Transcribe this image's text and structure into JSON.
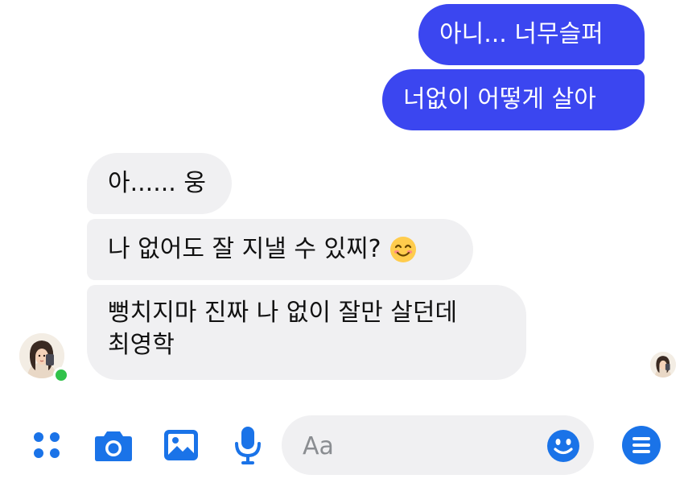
{
  "messages": {
    "sent": [
      {
        "text": "아니... 너무슬퍼"
      },
      {
        "text": "너없이 어떻게 살아"
      }
    ],
    "received": [
      {
        "text": "아...... 웅"
      },
      {
        "text": "나 없어도 잘 지낼 수 있찌?"
      },
      {
        "lines": [
          "뻥치지마 진짜 나 없이 잘만 살던데",
          "최영학"
        ]
      }
    ],
    "received_emoji": "smiling-face-emoji"
  },
  "composer": {
    "placeholder": "Aa"
  },
  "toolbar": {
    "icons": [
      "apps-icon",
      "camera-icon",
      "gallery-icon",
      "microphone-icon",
      "emoji-icon",
      "menu-icon"
    ]
  },
  "colors": {
    "sent_bubble": "#3b46f0",
    "received_bubble": "#f0f0f2",
    "accent": "#1a73e8",
    "online": "#31c24a"
  },
  "status": {
    "contact_online": true
  }
}
